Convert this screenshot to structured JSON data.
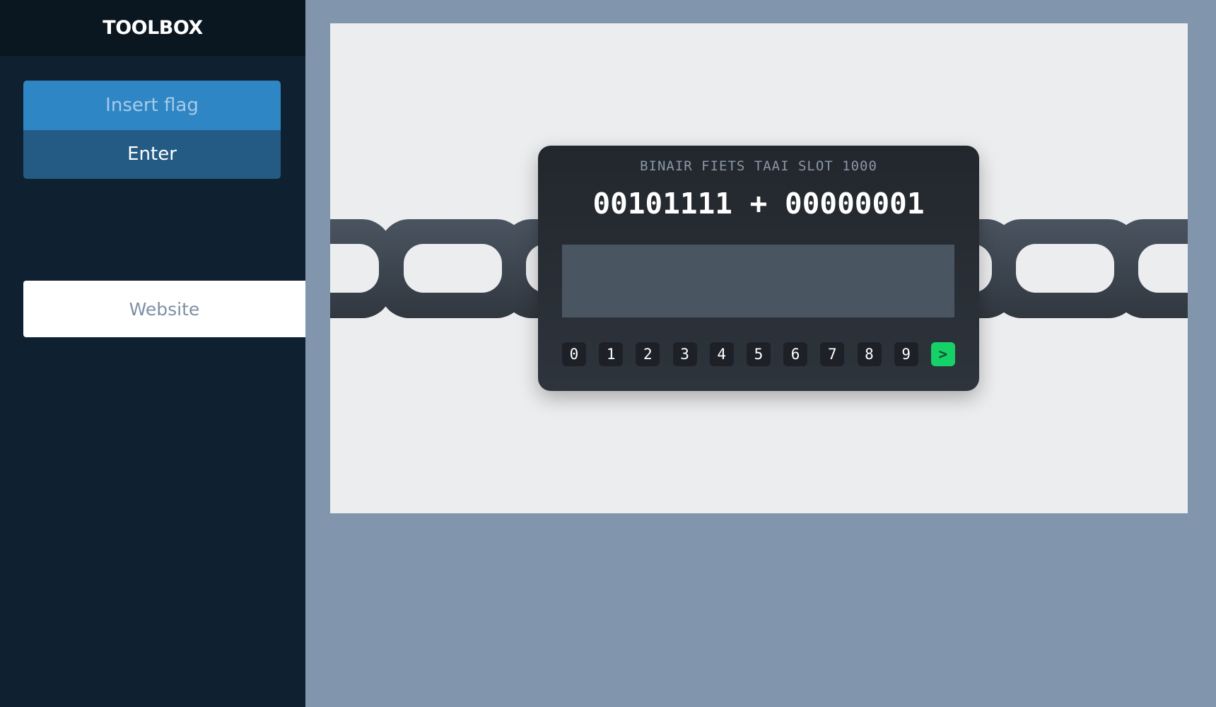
{
  "sidebar": {
    "title": "TOOLBOX",
    "insert_flag_label": "Insert flag",
    "enter_label": "Enter",
    "website_label": "Website"
  },
  "lock": {
    "title": "BINAIR FIETS TAAI SLOT 1000",
    "equation": "00101111 + 00000001",
    "answer_value": "",
    "keys": [
      "0",
      "1",
      "2",
      "3",
      "4",
      "5",
      "6",
      "7",
      "8",
      "9"
    ],
    "submit_label": ">"
  },
  "colors": {
    "sidebar_bg": "#0f2131",
    "accent_blue": "#2e86c5",
    "submit_green": "#16d168",
    "page_bg": "#8196ad"
  }
}
